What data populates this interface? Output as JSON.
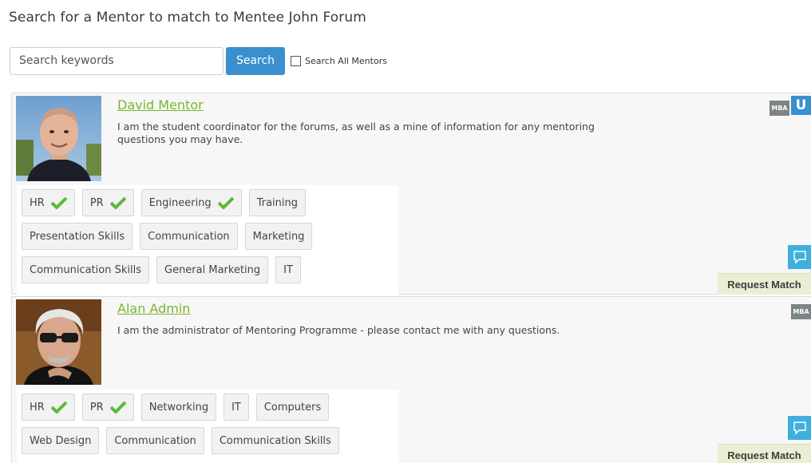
{
  "header": {
    "title": "Search for a Mentor to match to Mentee John Forum"
  },
  "search": {
    "placeholder": "Search keywords",
    "button_label": "Search",
    "search_all_label": "Search All Mentors",
    "search_all_checked": false
  },
  "colors": {
    "accent": "#3a8fcf",
    "name_link": "#7ab52d",
    "check": "#5cb83c",
    "chat": "#3fb0dc",
    "request_bg": "#e9efd2"
  },
  "mentors": [
    {
      "name": "David Mentor",
      "bio": "I am the student coordinator for the forums, as well as a mine of information for any mentoring questions you may have.",
      "badges": [
        "MBA",
        "U"
      ],
      "tags": [
        [
          {
            "label": "HR",
            "matched": true
          },
          {
            "label": "PR",
            "matched": true
          },
          {
            "label": "Engineering",
            "matched": true
          },
          {
            "label": "Training",
            "matched": false
          }
        ],
        [
          {
            "label": "Presentation Skills",
            "matched": false
          },
          {
            "label": "Communication",
            "matched": false
          },
          {
            "label": "Marketing",
            "matched": false
          }
        ],
        [
          {
            "label": "Communication Skills",
            "matched": false
          },
          {
            "label": "General Marketing",
            "matched": false
          },
          {
            "label": "IT",
            "matched": false
          }
        ]
      ],
      "chat_icon": "speech-bubble-icon",
      "request_label": "Request Match"
    },
    {
      "name": "Alan Admin",
      "bio": "I am the administrator of Mentoring Programme - please contact me with any questions.",
      "badges": [
        "MBA"
      ],
      "tags": [
        [
          {
            "label": "HR",
            "matched": true
          },
          {
            "label": "PR",
            "matched": true
          },
          {
            "label": "Networking",
            "matched": false
          },
          {
            "label": "IT",
            "matched": false
          },
          {
            "label": "Computers",
            "matched": false
          }
        ],
        [
          {
            "label": "Web Design",
            "matched": false
          },
          {
            "label": "Communication",
            "matched": false
          },
          {
            "label": "Communication Skills",
            "matched": false
          }
        ]
      ],
      "chat_icon": "speech-bubble-icon",
      "request_label": "Request Match"
    }
  ]
}
